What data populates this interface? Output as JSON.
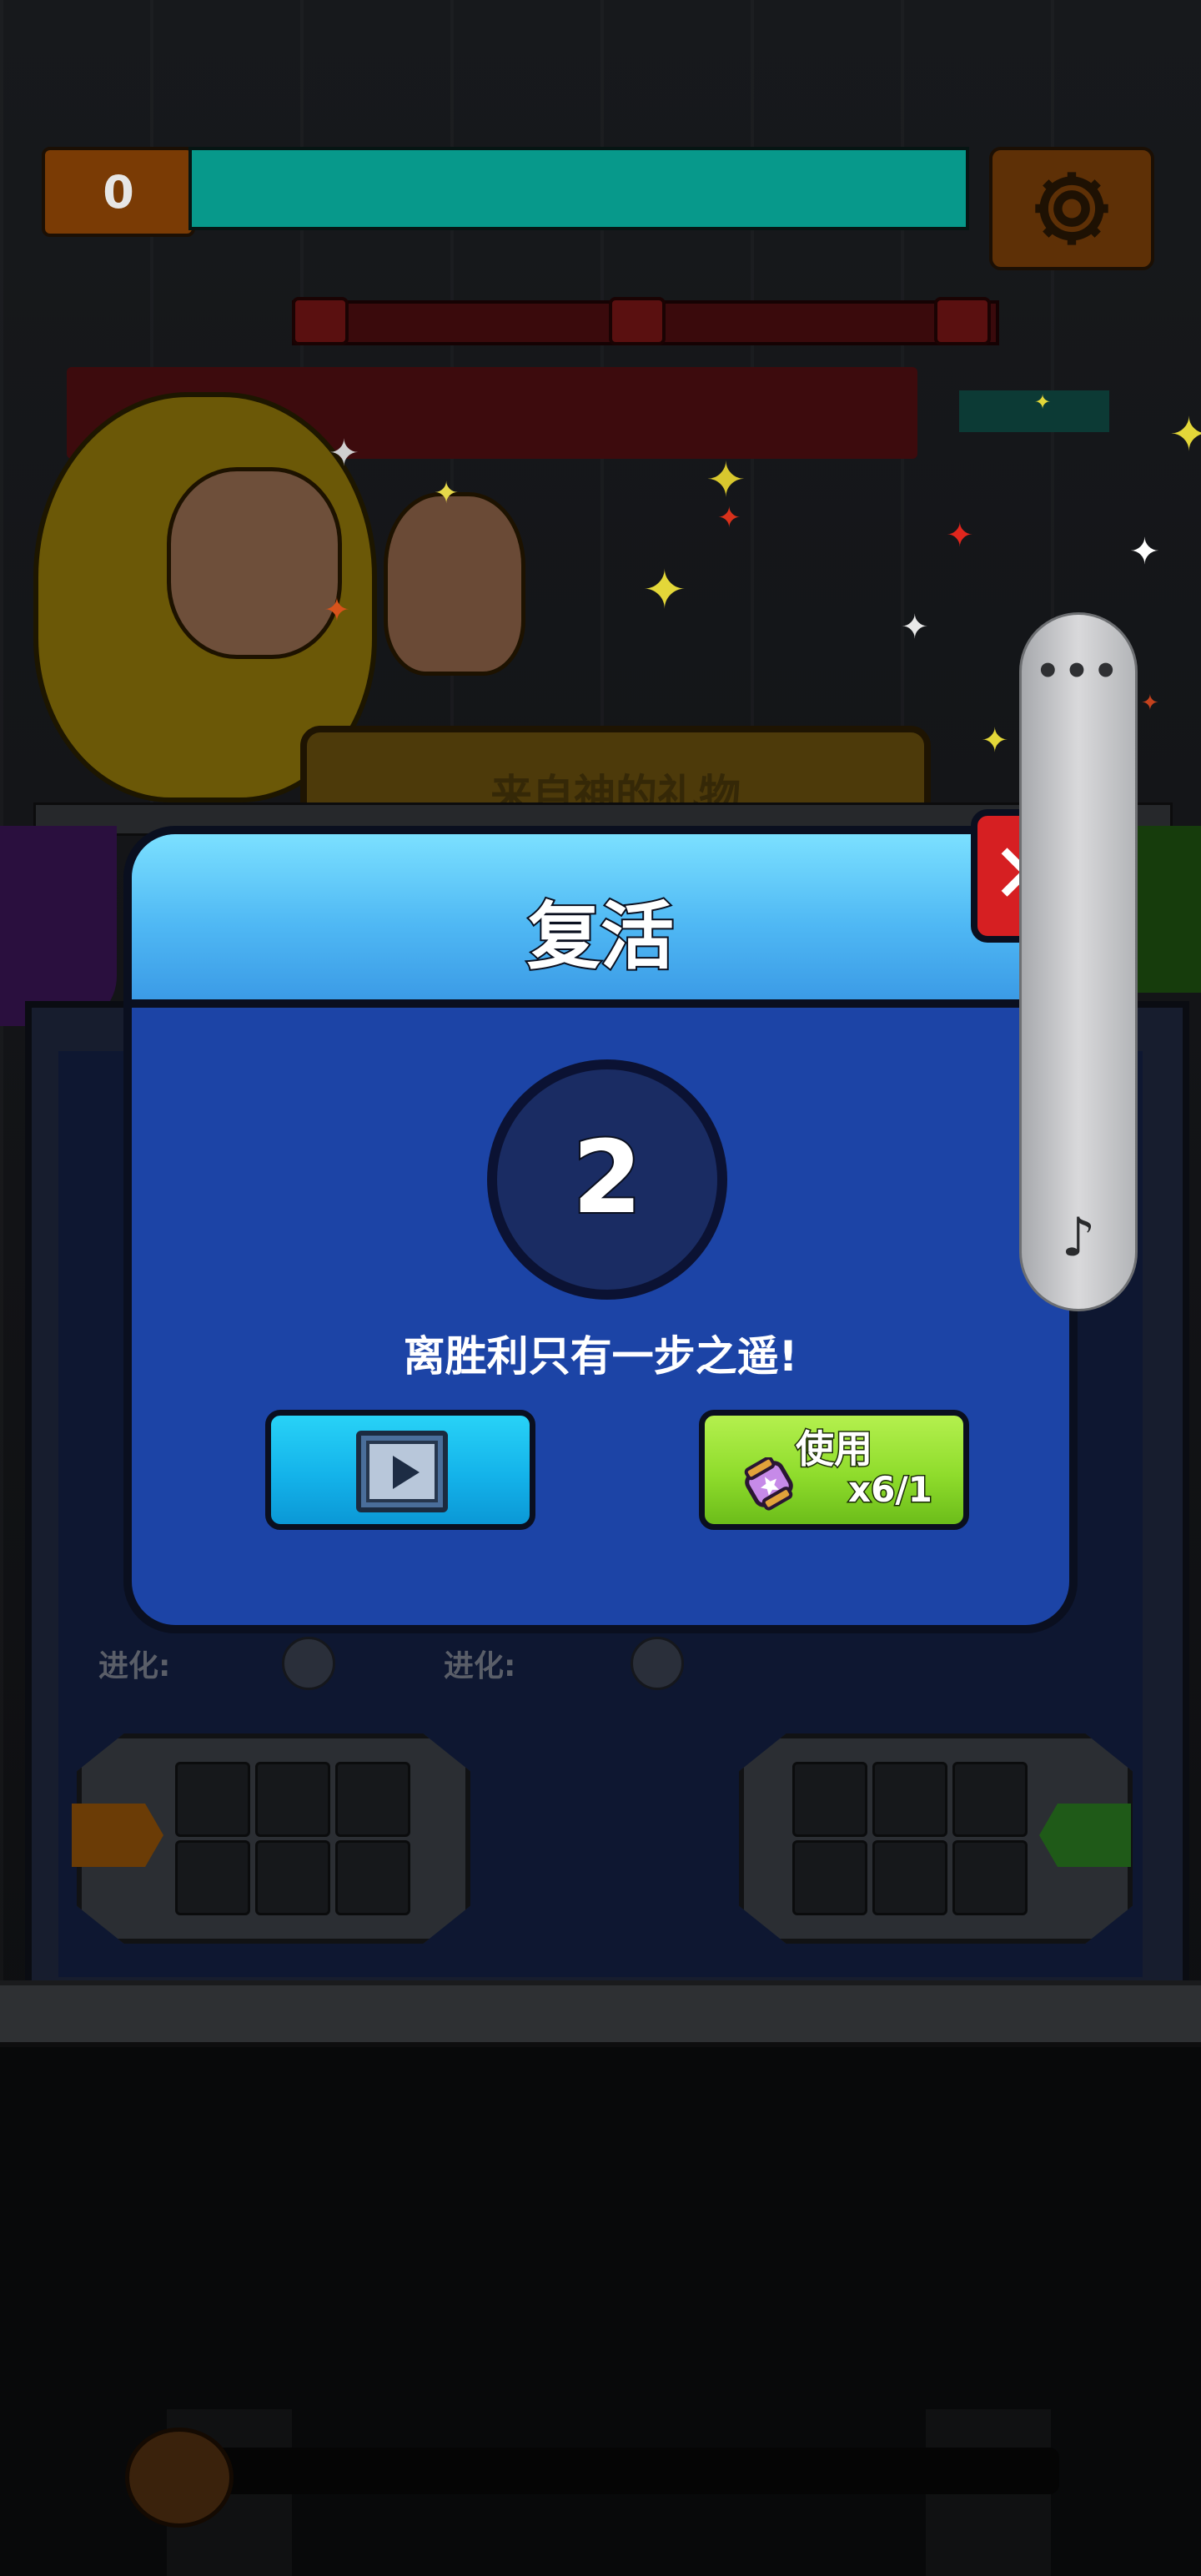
{
  "hud": {
    "score": "0",
    "hp_fraction": 1.0,
    "settings_icon": "gear-icon"
  },
  "scene": {
    "gift_banner": "来自神的礼物",
    "evolution_label_1": "进化:",
    "evolution_label_2": "进化:"
  },
  "revive_dialog": {
    "title": "复活",
    "countdown": "2",
    "message": "离胜利只有一步之遥!",
    "video_button_icon": "play-icon",
    "use_button": {
      "label": "使用",
      "count": "x6/1",
      "icon": "revive-potion-icon"
    },
    "close_icon": "close-icon"
  },
  "side_panel": {
    "menu_icon": "more-dots-icon",
    "music_icon": "music-note-icon"
  },
  "colors": {
    "modal_blue": "#1c44a6",
    "header_blue": "#4fb8f4",
    "video_button": "#14b3ea",
    "use_button": "#8fdc2c",
    "close_button": "#d61f22"
  }
}
